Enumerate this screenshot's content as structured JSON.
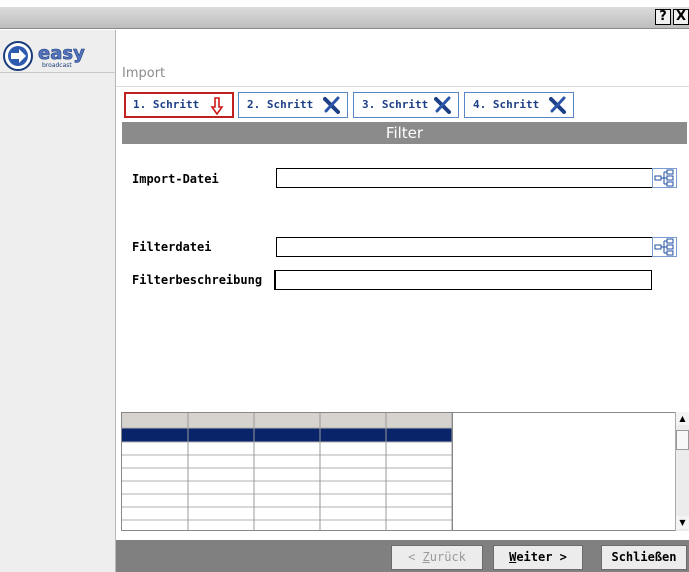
{
  "window": {
    "help_glyph": "?",
    "close_glyph": "X"
  },
  "sidebar": {
    "logo_icon": "easy-broadcast-logo",
    "logo_word": "easy",
    "logo_sub": "broadcast"
  },
  "page": {
    "heading": "Import",
    "banner": "Filter"
  },
  "steps": [
    {
      "label": "1. Schritt",
      "icon": "arrow-down-icon",
      "active": true
    },
    {
      "label": "2. Schritt",
      "icon": "x-tool-icon",
      "active": false
    },
    {
      "label": "3. Schritt",
      "icon": "x-tool-icon",
      "active": false
    },
    {
      "label": "4. Schritt",
      "icon": "x-tool-icon",
      "active": false
    }
  ],
  "form": {
    "import_file_label": "Import-Datei",
    "import_file_value": "",
    "filter_file_label": "Filterdatei",
    "filter_file_value": "",
    "filter_desc_label": "Filterbeschreibung",
    "filter_desc_value": ""
  },
  "grid": {
    "columns": 5,
    "rows": 8,
    "selected_row": 0
  },
  "buttons": {
    "back": {
      "prefix": "< ",
      "mnemonic": "Z",
      "rest": "urück"
    },
    "next": {
      "mnemonic": "W",
      "rest": "eiter >"
    },
    "close": "Schließen"
  },
  "colors": {
    "accent_blue": "#1c3f86",
    "active_step_border": "#c02020",
    "banner_gray": "#8b8b8b",
    "selected_row": "#0a246a"
  }
}
